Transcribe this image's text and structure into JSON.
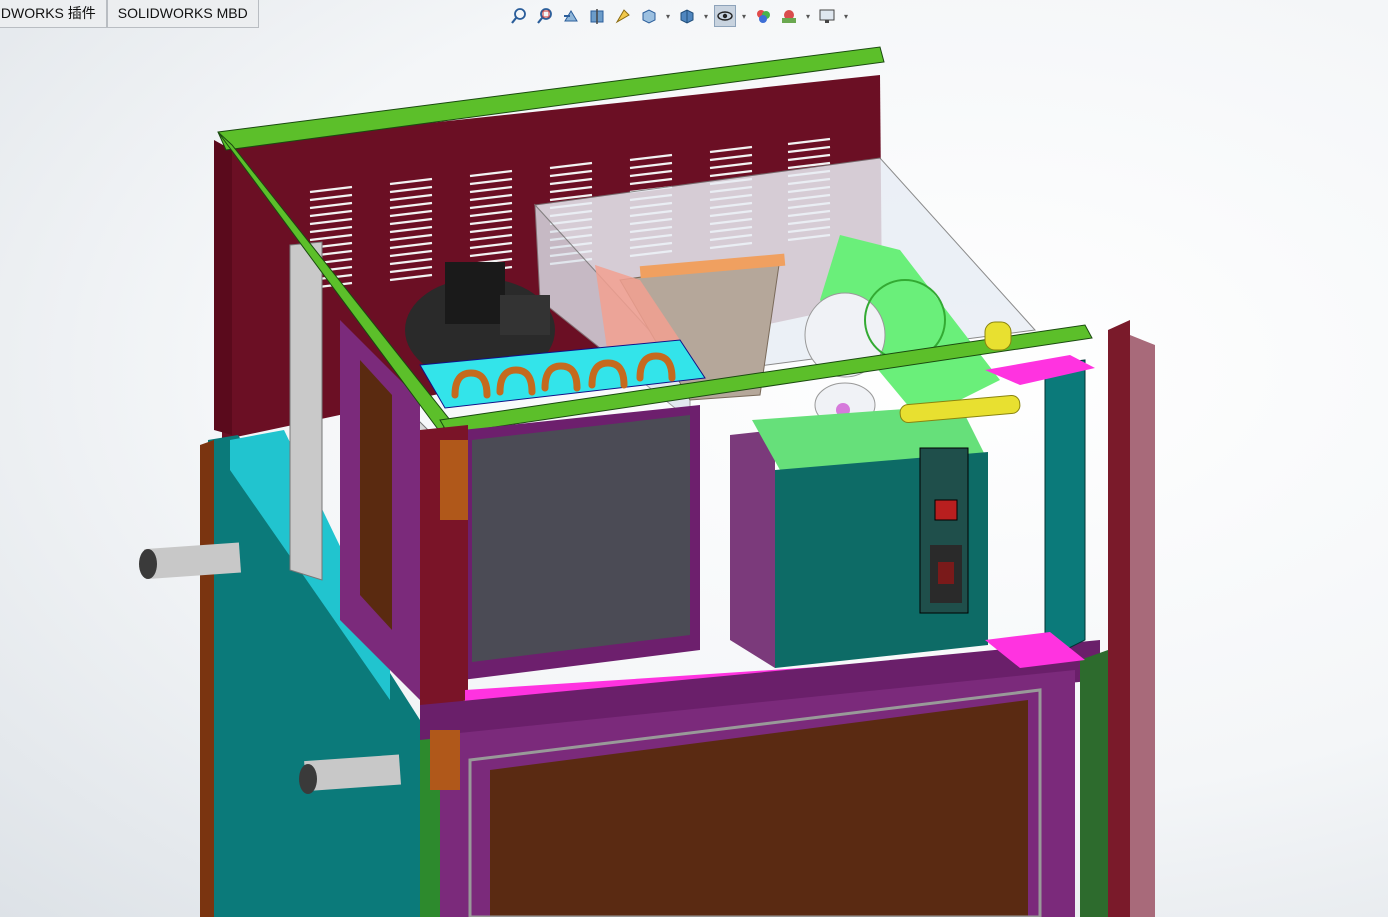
{
  "tabs": [
    "IDWORKS 插件",
    "SOLIDWORKS MBD"
  ],
  "toolbar": {
    "icons": [
      "zoom-to-fit-icon",
      "zoom-to-area-icon",
      "previous-view-icon",
      "section-view-icon",
      "dynamic-annotation-icon",
      "view-orientation-icon",
      "display-style-icon",
      "hide-show-items-icon",
      "edit-appearance-icon",
      "apply-scene-icon",
      "view-settings-icon"
    ],
    "active": "hide-show-items-icon"
  },
  "model": {
    "description_colors": {
      "frame": "#6b0f24",
      "top_rail": "#5cbf2a",
      "side_panel": "#0b7a7a",
      "control_box": "#0d6b66",
      "door": "#5a2a12",
      "magenta_rail": "#ff33e0"
    }
  }
}
